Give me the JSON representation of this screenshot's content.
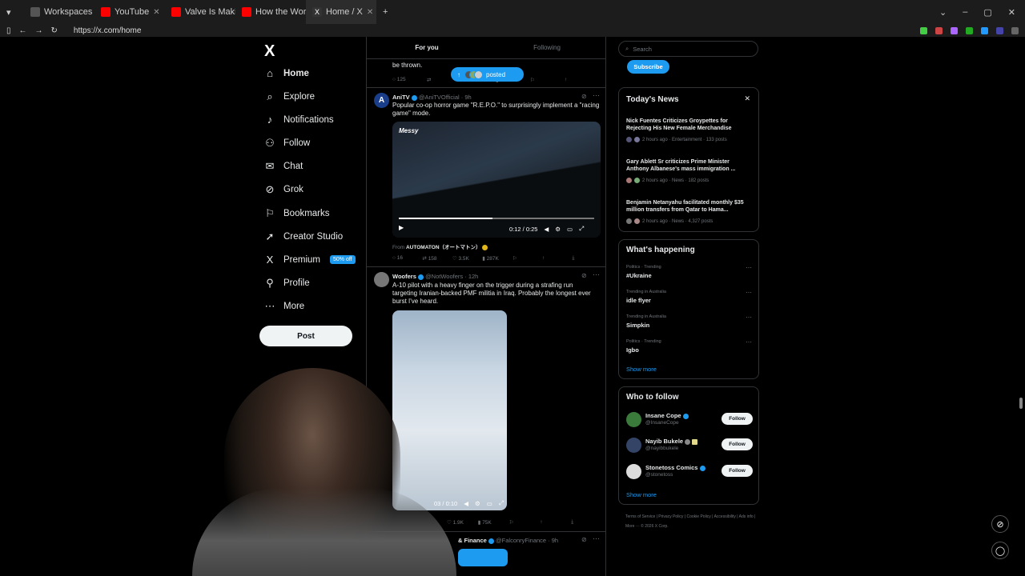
{
  "browser": {
    "tabs": [
      {
        "label": "Workspaces",
        "color": "#555555"
      },
      {
        "label": "YouTube",
        "color": "#ff0000"
      },
      {
        "label": "Valve Is Making Some",
        "color": "#ff0000"
      },
      {
        "label": "How the World's Large",
        "color": "#ff0000"
      },
      {
        "label": "Home / X",
        "color": "#333333"
      }
    ],
    "new_tab": "+",
    "url": "https://x.com/home"
  },
  "sidebar": {
    "logo": "X",
    "items": [
      {
        "label": "Home",
        "icon": "⌂"
      },
      {
        "label": "Explore",
        "icon": "⌕"
      },
      {
        "label": "Notifications",
        "icon": "♪"
      },
      {
        "label": "Follow",
        "icon": "⚇"
      },
      {
        "label": "Chat",
        "icon": "✉"
      },
      {
        "label": "Grok",
        "icon": "⊘"
      },
      {
        "label": "Bookmarks",
        "icon": "⚐"
      },
      {
        "label": "Creator Studio",
        "icon": "➚"
      },
      {
        "label": "Premium",
        "icon": "X",
        "badge": "50% off"
      },
      {
        "label": "Profile",
        "icon": "⚲"
      },
      {
        "label": "More",
        "icon": "⋯"
      }
    ],
    "post_label": "Post"
  },
  "feed": {
    "tabs": [
      "For you",
      "Following"
    ],
    "top_fragment": "be thrown.",
    "top_actions": {
      "replies": "125",
      "views": "66K"
    },
    "posted_pill": "posted",
    "tweets": [
      {
        "name": "AniTV",
        "handle": "@AniTVOfficial",
        "time": "9h",
        "text": "Popular co-op horror game \"R.E.P.O.\" to surprisingly implement a \"racing game\" mode.",
        "video_time": "0:12 / 0:25",
        "video_caption": "Messy",
        "from_prefix": "From",
        "from_source": "AUTOMATON（オートマトン）",
        "replies": "16",
        "reposts": "158",
        "likes": "3.5K",
        "views": "287K"
      },
      {
        "name": "Woofers",
        "handle": "@NotWoofers",
        "time": "12h",
        "text": "A-10 pilot with a heavy finger on the trigger during a strafing run targeting Iranian-backed PMF militia in Iraq. Probably the longest ever burst I've heard.",
        "video_time": "03 / 0:10",
        "likes": "1.9K",
        "views": "75K"
      },
      {
        "name": "& Finance",
        "handle": "@FalconryFinance",
        "time": "9h"
      }
    ]
  },
  "right": {
    "search_placeholder": "Search",
    "subscribe": "Subscribe",
    "news_title": "Today's News",
    "news": [
      {
        "title": "Nick Fuentes Criticizes Groypettes for Rejecting His New Female Merchandise",
        "meta": "2 hours ago · Entertainment · 133 posts"
      },
      {
        "title": "Gary Ablett Sr criticizes Prime Minister Anthony Albanese's mass immigration ...",
        "meta": "2 hours ago · News · 182 posts"
      },
      {
        "title": "Benjamin Netanyahu facilitated monthly $35 million transfers from Qatar to Hama...",
        "meta": "2 hours ago · News · 4,327 posts"
      }
    ],
    "happening_title": "What's happening",
    "trends": [
      {
        "context": "Politics · Trending",
        "name": "#Ukraine"
      },
      {
        "context": "Trending in Australia",
        "name": "idle flyer"
      },
      {
        "context": "Trending in Australia",
        "name": "Simpkin"
      },
      {
        "context": "Politics · Trending",
        "name": "Igbo"
      }
    ],
    "show_more": "Show more",
    "wtf_title": "Who to follow",
    "who_to_follow": [
      {
        "name": "Insane Cope",
        "handle": "@InsaneCope",
        "color": "#3a7a3a"
      },
      {
        "name": "Nayib Bukele",
        "handle": "@nayibbukele",
        "color": "#334466"
      },
      {
        "name": "Stonetoss Comics",
        "handle": "@stonetoss",
        "color": "#dddddd"
      }
    ],
    "follow_label": "Follow",
    "footer": "Terms of Service  |  Privacy Policy  |  Cookie Policy  |  Accessibility  |  Ads info  |  More ···  © 2026 X Corp."
  },
  "colors": {
    "accent": "#1d9bf0",
    "border": "#2f3336",
    "muted": "#71767b"
  }
}
